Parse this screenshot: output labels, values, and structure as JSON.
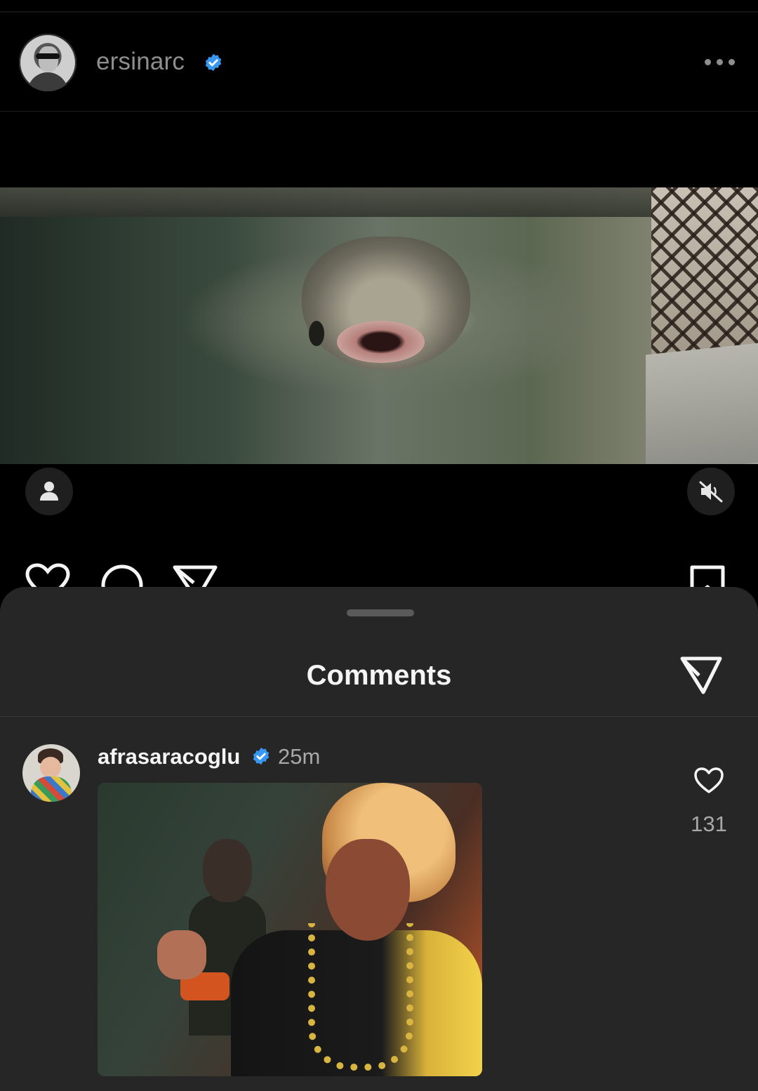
{
  "post": {
    "username": "ersinarc",
    "verified": true,
    "avatar_icon": "profile-photo",
    "more_icon": "more-horizontal-icon"
  },
  "video": {
    "user_tag_icon": "person-icon",
    "muted": true,
    "mute_icon": "speaker-muted-icon"
  },
  "actions": {
    "like_icon": "heart-icon",
    "comment_icon": "comment-icon",
    "share_icon": "paper-plane-icon",
    "save_icon": "bookmark-icon"
  },
  "comments_sheet": {
    "title": "Comments",
    "share_icon": "paper-plane-icon",
    "comments": [
      {
        "username": "afrasaracoglu",
        "verified": true,
        "time": "25m",
        "like_count": "131",
        "has_gif": true
      }
    ]
  },
  "colors": {
    "background": "#000000",
    "sheet": "#262626",
    "verified_blue": "#3897f0",
    "muted_text": "#a8a8a8"
  }
}
